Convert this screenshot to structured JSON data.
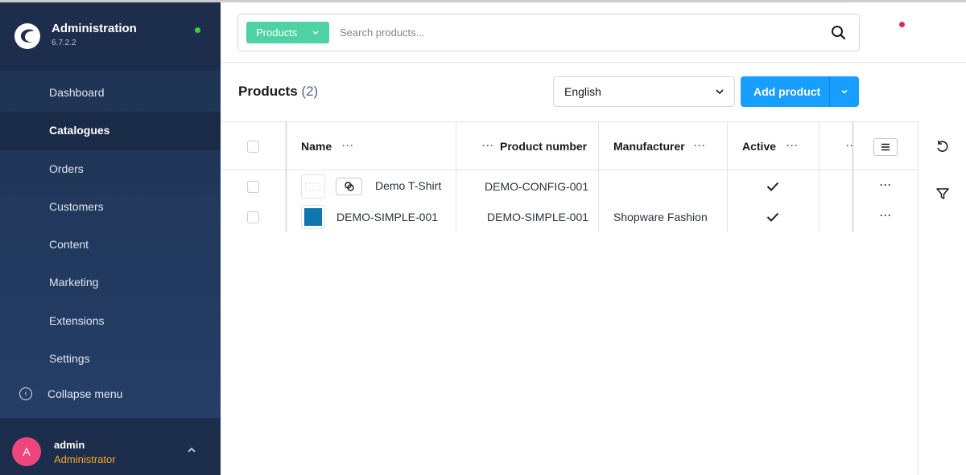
{
  "app": {
    "title": "Administration",
    "version": "6.7.2.2"
  },
  "sidebar": {
    "items": [
      {
        "label": "Dashboard"
      },
      {
        "label": "Catalogues",
        "active": true
      },
      {
        "label": "Orders"
      },
      {
        "label": "Customers"
      },
      {
        "label": "Content"
      },
      {
        "label": "Marketing"
      },
      {
        "label": "Extensions"
      },
      {
        "label": "Settings"
      }
    ],
    "collapse_label": "Collapse menu"
  },
  "user": {
    "initial": "A",
    "name": "admin",
    "role": "Administrator",
    "avatar_color": "#f0467e"
  },
  "search": {
    "type_label": "Products",
    "placeholder": "Search products...",
    "accent": "#4fd2a1"
  },
  "header": {
    "title": "Products",
    "count": "(2)",
    "language": "English",
    "add_label": "Add product",
    "accent": "#189eff"
  },
  "grid": {
    "columns": [
      "Name",
      "Product number",
      "Manufacturer",
      "Active"
    ],
    "rows": [
      {
        "name": "Demo T-Shirt",
        "number": "DEMO-CONFIG-001",
        "manufacturer": "",
        "active": true,
        "variants": true,
        "thumb": "placeholder"
      },
      {
        "name": "DEMO-SIMPLE-001",
        "number": "DEMO-SIMPLE-001",
        "manufacturer": "Shopware Fashion",
        "active": true,
        "variants": false,
        "thumb": "#0f76b0"
      }
    ]
  },
  "icons": [
    "search-icon",
    "reset-icon",
    "filter-icon",
    "chevron-down-icon",
    "chevron-up-icon",
    "list-settings-icon",
    "link-icon",
    "checkmark-icon",
    "collapse-icon"
  ]
}
